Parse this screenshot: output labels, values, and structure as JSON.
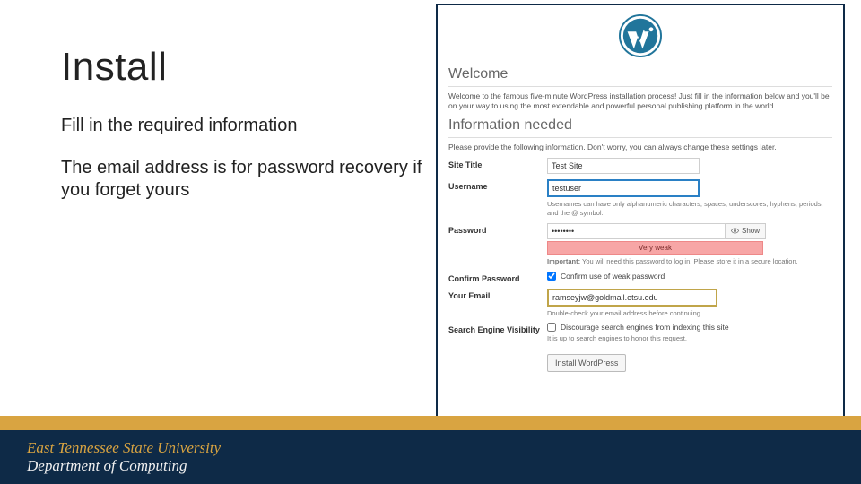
{
  "slide": {
    "title": "Install",
    "para1": "Fill in the required information",
    "para2": "The email address is for password recovery if you forget yours"
  },
  "footer": {
    "line1": "East Tennessee State University",
    "line2": "Department of Computing"
  },
  "wp": {
    "welcome_head": "Welcome",
    "welcome_text": "Welcome to the famous five-minute WordPress installation process! Just fill in the information below and you'll be on your way to using the most extendable and powerful personal publishing platform in the world.",
    "info_head": "Information needed",
    "info_text": "Please provide the following information. Don't worry, you can always change these settings later.",
    "site_title_label": "Site Title",
    "site_title_value": "Test Site",
    "username_label": "Username",
    "username_value": "testuser",
    "username_hint": "Usernames can have only alphanumeric characters, spaces, underscores, hyphens, periods, and the @ symbol.",
    "password_label": "Password",
    "password_value": "••••••••",
    "show_label": "Show",
    "strength_label": "Very weak",
    "password_hint_prefix": "Important:",
    "password_hint": " You will need this password to log in. Please store it in a secure location.",
    "confirm_label": "Confirm Password",
    "confirm_check_label": "Confirm use of weak password",
    "email_label": "Your Email",
    "email_value": "ramseyjw@goldmail.etsu.edu",
    "email_hint": "Double-check your email address before continuing.",
    "search_label": "Search Engine Visibility",
    "search_check_label": "Discourage search engines from indexing this site",
    "search_hint": "It is up to search engines to honor this request.",
    "install_btn": "Install WordPress"
  }
}
